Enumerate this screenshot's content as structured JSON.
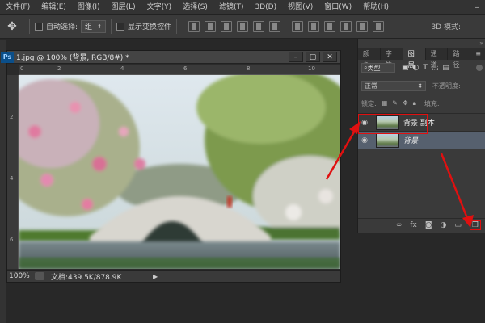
{
  "menubar": {
    "items": [
      "文件(F)",
      "编辑(E)",
      "图像(I)",
      "图层(L)",
      "文字(Y)",
      "选择(S)",
      "滤镜(T)",
      "3D(D)",
      "视图(V)",
      "窗口(W)",
      "帮助(H)"
    ]
  },
  "options": {
    "auto_select_label": "自动选择:",
    "auto_select_value": "组",
    "show_transform_label": "显示变换控件",
    "mode_3d": "3D 模式:"
  },
  "document": {
    "badge": "Ps",
    "title": "1.jpg @ 100% (背景, RGB/8#) *",
    "zoom": "100%",
    "docinfo": "文档:439.5K/878.9K",
    "ruler_h": [
      "0",
      "2",
      "4",
      "6",
      "8",
      "10"
    ],
    "ruler_v": [
      "2",
      "4",
      "6"
    ]
  },
  "panel": {
    "tabs": [
      "颜色",
      "字符",
      "图层",
      "通道",
      "路径"
    ],
    "active_tab": "图层",
    "filter_label": "类型",
    "blend_mode": "正常",
    "opacity_label": "不透明度:",
    "lock_label": "锁定:",
    "fill_label": "填充:",
    "layers": [
      {
        "name": "背景 副本"
      },
      {
        "name": "背景"
      }
    ]
  },
  "colors": {
    "highlight": "#e01010",
    "selected_layer": "#56606e"
  }
}
